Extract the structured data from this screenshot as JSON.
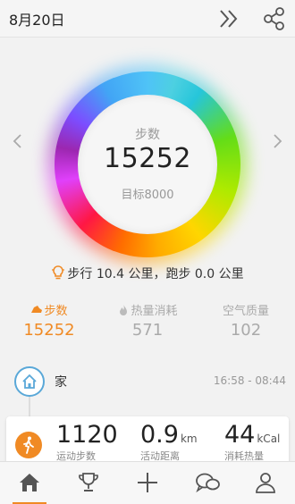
{
  "header": {
    "date": "8月20日",
    "icons": [
      "double-chevron-right-icon",
      "share-icon"
    ]
  },
  "ring": {
    "label": "步数",
    "value": "15252",
    "goal_text": "目标8000",
    "progress": 1.0,
    "colors": [
      "#4fc3f7",
      "#64dd17",
      "#ffd600",
      "#ff6d00",
      "#ff1744",
      "#e040fb",
      "#7c4dff"
    ]
  },
  "summary": {
    "text": "步行 10.4 公里，跑步 0.0 公里",
    "icon": "lightbulb-icon"
  },
  "stats": [
    {
      "label": "步数",
      "value": "15252",
      "active": true,
      "icon": "shoe-icon"
    },
    {
      "label": "热量消耗",
      "value": "571",
      "active": false,
      "icon": "flame-icon"
    },
    {
      "label": "空气质量",
      "value": "102",
      "active": false
    }
  ],
  "timeline": {
    "location": "家",
    "time_range": "16:58 - 08:44",
    "icon": "home-icon"
  },
  "activity_card": {
    "icon": "walking-person-icon",
    "steps": {
      "value": "1120",
      "unit": "",
      "label": "运动步数"
    },
    "distance": {
      "value": "0.9",
      "unit": "km",
      "label": "活动距离"
    },
    "calories": {
      "value": "44",
      "unit": "kCal",
      "label": "消耗热量"
    }
  },
  "tabbar": {
    "tabs": [
      "home-icon",
      "trophy-icon",
      "plus-icon",
      "chat-bubbles-icon",
      "profile-icon"
    ],
    "active_index": 0
  },
  "colors": {
    "accent": "#f08a24",
    "home_node": "#5aa8d8",
    "muted": "#aaaaaa"
  }
}
